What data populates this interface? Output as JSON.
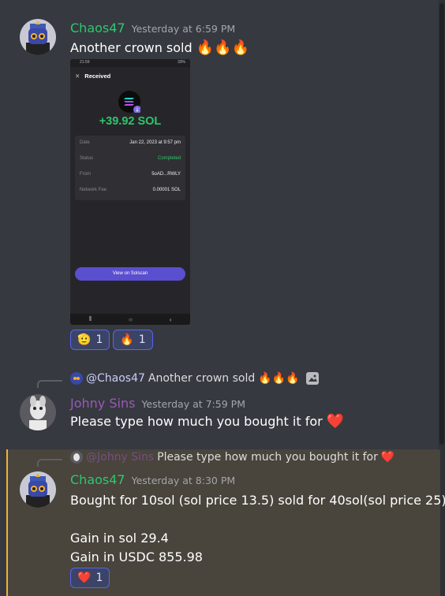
{
  "colors": {
    "chaos_name": "#2dc770",
    "johny_name": "#9b59b6",
    "mention": "#c9cdfb",
    "highlight_bg": "#49443c",
    "highlight_bar": "#f0b232",
    "sol_green": "#30c56a",
    "solscan_button": "#5a4fcf"
  },
  "messages": [
    {
      "author": "Chaos47",
      "timestamp": "Yesterday at 6:59 PM",
      "text": "Another crown sold",
      "emoji": "🔥🔥🔥",
      "attachment": {
        "status_time": "21:59",
        "status_right": "33%",
        "header": "Received",
        "amount": "+39.92 SOL",
        "rows": [
          {
            "label": "Date",
            "value": "Jan 22, 2023 at 9:57 pm"
          },
          {
            "label": "Status",
            "value": "Completed"
          },
          {
            "label": "From",
            "value": "5oAD...RWLY"
          },
          {
            "label": "Network Fee",
            "value": "0.00001 SOL"
          }
        ],
        "button": "View on Solscan"
      },
      "reactions": [
        {
          "icon": "🫡",
          "count": "1"
        },
        {
          "icon": "🔥",
          "count": "1"
        }
      ]
    },
    {
      "reply": {
        "mention": "@Chaos47",
        "text": "Another crown sold",
        "emoji": "🔥🔥🔥"
      },
      "author": "Johny Sins",
      "timestamp": "Yesterday at 7:59 PM",
      "text": "Please type how much you bought it for",
      "emoji": "❤️"
    },
    {
      "reply": {
        "mention": "@Johny Sins",
        "text": "Please type how much you bought it for",
        "emoji": "❤️"
      },
      "author": "Chaos47",
      "timestamp": "Yesterday at 8:30 PM",
      "lines": [
        "Bought for 10sol (sol price 13.5) sold for 40sol(sol price 25)",
        "Gain in sol 29.4",
        "Gain in USDC 855.98"
      ],
      "reactions": [
        {
          "icon": "❤️",
          "count": "1"
        }
      ]
    }
  ]
}
